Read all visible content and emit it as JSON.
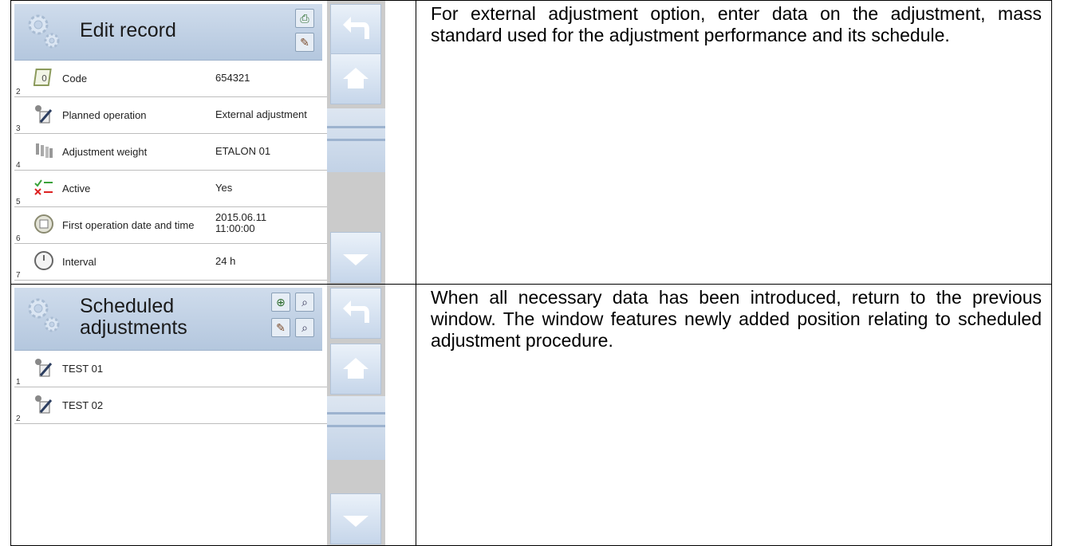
{
  "top": {
    "screen": {
      "title": "Edit record",
      "rows": [
        {
          "num": "2",
          "label": "Code",
          "value": "654321",
          "icon": "code-icon"
        },
        {
          "num": "3",
          "label": "Planned operation",
          "value": "External adjustment",
          "icon": "operation-icon"
        },
        {
          "num": "4",
          "label": "Adjustment weight",
          "value": "ETALON 01",
          "icon": "weights-icon"
        },
        {
          "num": "5",
          "label": "Active",
          "value": "Yes",
          "icon": "active-toggle-icon"
        },
        {
          "num": "6",
          "label": "First operation date and time",
          "value": "2015.06.11\n11:00:00",
          "icon": "calendar-icon"
        },
        {
          "num": "7",
          "label": "Interval",
          "value": "24 h",
          "icon": "clock-icon"
        }
      ]
    },
    "description": "For external adjustment option, enter data on the adjustment, mass standard used for the adjustment performance and its schedule."
  },
  "bottom": {
    "screen": {
      "title_line1": "Scheduled",
      "title_line2": "adjustments",
      "rows": [
        {
          "num": "1",
          "label": "TEST 01",
          "icon": "operation-icon"
        },
        {
          "num": "2",
          "label": "TEST 02",
          "icon": "operation-icon"
        }
      ]
    },
    "description": "When all necessary data has been introduced, return to the previous window. The window features newly added position relating to scheduled adjustment procedure."
  },
  "colors": {
    "header": "#c3d3e7",
    "sidebar": "#cbcbcb",
    "button": "#d6e2f1"
  }
}
